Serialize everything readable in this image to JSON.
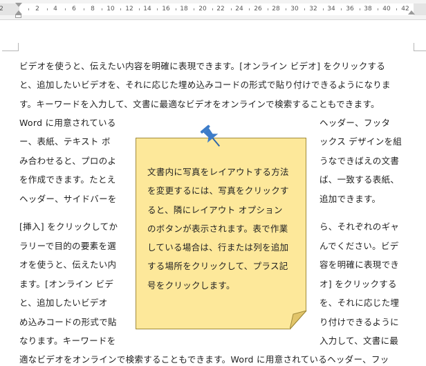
{
  "ruler": {
    "numbers": [
      "2",
      "2",
      "4",
      "6",
      "8",
      "10",
      "12",
      "14",
      "16",
      "18",
      "20",
      "22",
      "24",
      "26",
      "28",
      "30",
      "32",
      "34",
      "36",
      "38",
      "40",
      "42"
    ]
  },
  "document": {
    "paragraph1": [
      "ビデオを使うと、伝えたい内容を明確に表現できます。[オンライン ビデオ] をクリックする",
      "と、追加したいビデオを、それに応じた埋め込みコードの形式で貼り付けできるようになりま",
      "す。キーワードを入力して、文書に最適なビデオをオンラインで検索することもできます。"
    ],
    "paragraph2_left": [
      "Word に用意されている",
      "ー、表紙、テキスト ボ",
      "み合わせると、プロのよ",
      "を作成できます。たとえ",
      "ヘッダー、サイドバーを"
    ],
    "paragraph2_right": [
      "ヘッダー、フッタ",
      "ックス デザインを組",
      "うなできばえの文書",
      "ば、一致する表紙、",
      "追加できます。"
    ],
    "paragraph3_left": [
      "[挿入] をクリックしてか",
      "ラリーで目的の要素を選",
      "オを使うと、伝えたい内",
      "ます。[オンライン ビデ",
      "と、追加したいビデオ",
      "め込みコードの形式で貼",
      "なります。キーワードを"
    ],
    "paragraph3_right": [
      "ら、それぞれのギャ",
      "んでください。ビデ",
      "容を明確に表現でき",
      "オ] をクリックする",
      "を、それに応じた埋",
      "り付けできるように",
      "入力して、文書に最"
    ],
    "last_line": "適なビデオをオンラインで検索することもできます。Word に用意されているヘッダー、フッ"
  },
  "note": {
    "lines": [
      "文書内に写真をレイアウトする方法",
      "を変更するには、写真をクリックす",
      "ると、隣にレイアウト オプション",
      "のボタンが表示されます。表で作業",
      "している場合は、行または列を追加",
      "する場所をクリックして、プラス記",
      "号をクリックします。"
    ],
    "fill_color": "#fde89a",
    "pin_color": "#3d7cc9",
    "pin_icon": "pushpin-icon"
  }
}
